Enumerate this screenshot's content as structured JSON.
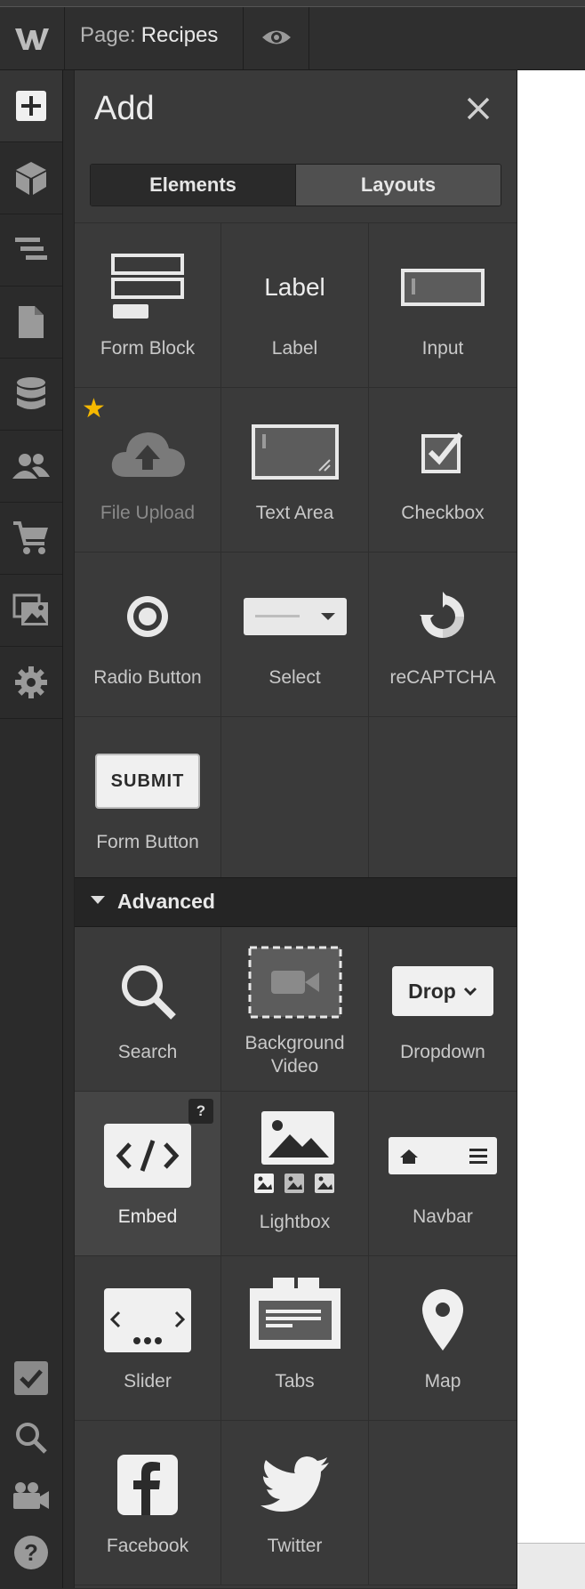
{
  "topbar": {
    "page_label": "Page:",
    "page_name": "Recipes",
    "logo_icon": "webflow-logo-icon",
    "preview_icon": "eye-icon"
  },
  "leftbar": {
    "items": [
      {
        "icon": "add-plus-icon",
        "active": true
      },
      {
        "icon": "cube-icon"
      },
      {
        "icon": "navigator-layers-icon"
      },
      {
        "icon": "pages-document-icon"
      },
      {
        "icon": "cms-database-icon"
      },
      {
        "icon": "users-icon"
      },
      {
        "icon": "ecommerce-cart-icon"
      },
      {
        "icon": "assets-images-icon"
      },
      {
        "icon": "settings-gear-icon"
      }
    ],
    "bottom_items": [
      {
        "icon": "audit-checkbox-icon"
      },
      {
        "icon": "search-icon"
      },
      {
        "icon": "video-tutorials-icon"
      },
      {
        "icon": "help-question-icon"
      }
    ]
  },
  "panel": {
    "title": "Add",
    "tabs": [
      "Elements",
      "Layouts"
    ],
    "active_tab": "Elements",
    "forms": [
      {
        "label": "Form Block",
        "icon": "form-block-icon"
      },
      {
        "label": "Label",
        "icon": "label-icon",
        "icon_text": "Label"
      },
      {
        "label": "Input",
        "icon": "input-icon"
      },
      {
        "label": "File Upload",
        "icon": "cloud-upload-icon",
        "dim": true,
        "starred": true
      },
      {
        "label": "Text Area",
        "icon": "text-area-icon"
      },
      {
        "label": "Checkbox",
        "icon": "checkbox-icon"
      },
      {
        "label": "Radio Button",
        "icon": "radio-button-icon"
      },
      {
        "label": "Select",
        "icon": "select-icon"
      },
      {
        "label": "reCAPTCHA",
        "icon": "recaptcha-icon"
      },
      {
        "label": "Form Button",
        "icon": "submit-button-icon",
        "icon_text": "SUBMIT"
      }
    ],
    "advanced_section": "Advanced",
    "advanced": [
      {
        "label": "Search",
        "icon": "search-icon"
      },
      {
        "label": "Background Video",
        "icon": "background-video-icon"
      },
      {
        "label": "Dropdown",
        "icon": "dropdown-icon",
        "icon_text": "Drop"
      },
      {
        "label": "Embed",
        "icon": "code-embed-icon",
        "highlight": true,
        "badge": "?"
      },
      {
        "label": "Lightbox",
        "icon": "lightbox-icon"
      },
      {
        "label": "Navbar",
        "icon": "navbar-icon"
      },
      {
        "label": "Slider",
        "icon": "slider-icon"
      },
      {
        "label": "Tabs",
        "icon": "tabs-icon"
      },
      {
        "label": "Map",
        "icon": "map-pin-icon"
      },
      {
        "label": "Facebook",
        "icon": "facebook-icon"
      },
      {
        "label": "Twitter",
        "icon": "twitter-icon"
      }
    ]
  },
  "colors": {
    "star": "#f5b800",
    "panel_bg": "#3a3a3a",
    "section_bg": "#252525"
  }
}
